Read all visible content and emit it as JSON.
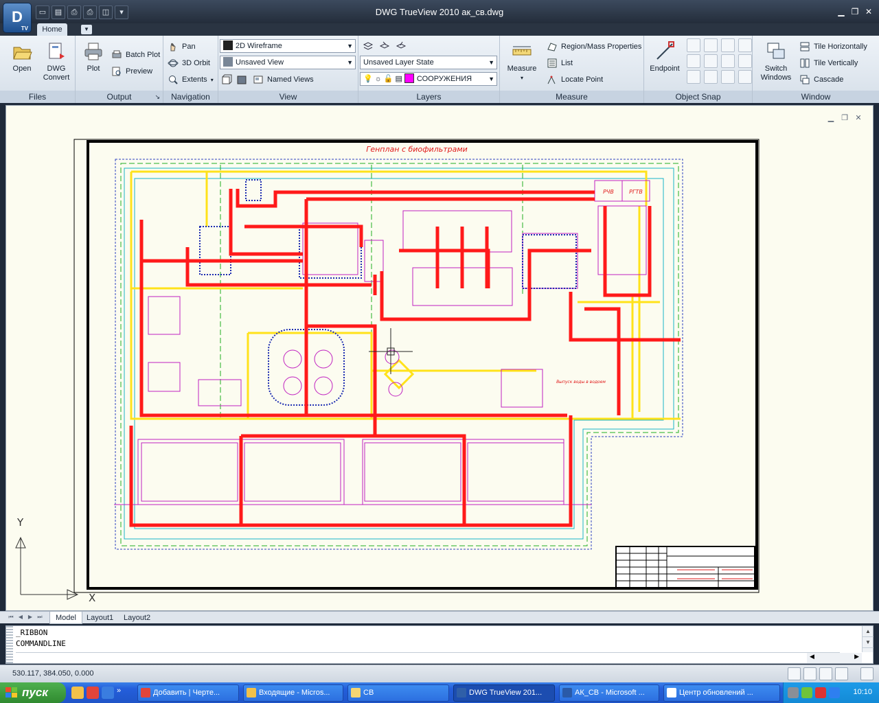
{
  "app": {
    "title": "DWG TrueView 2010    ак_св.dwg",
    "logo_text": "D",
    "logo_badge": "TV"
  },
  "tabs": {
    "home": "Home"
  },
  "ribbon": {
    "files": {
      "label": "Files",
      "open": "Open",
      "dwg_convert": "DWG\nConvert"
    },
    "output": {
      "label": "Output",
      "plot": "Plot",
      "batch_plot": "Batch Plot",
      "preview": "Preview"
    },
    "navigation": {
      "label": "Navigation",
      "pan": "Pan",
      "orbit": "3D Orbit",
      "extents": "Extents"
    },
    "view": {
      "label": "View",
      "visual_style": "2D Wireframe",
      "saved_view": "Unsaved View",
      "named_views": "Named Views"
    },
    "layers": {
      "label": "Layers",
      "layer_state": "Unsaved Layer State",
      "current_layer": "СООРУЖЕНИЯ",
      "layer_color": "#ff00ff"
    },
    "measure": {
      "label": "Measure",
      "measure": "Measure",
      "region": "Region/Mass Properties",
      "list": "List",
      "locate": "Locate Point"
    },
    "osnap": {
      "label": "Object Snap",
      "endpoint": "Endpoint"
    },
    "window": {
      "label": "Window",
      "switch": "Switch\nWindows",
      "tile_h": "Tile Horizontally",
      "tile_v": "Tile Vertically",
      "cascade": "Cascade"
    }
  },
  "drawing": {
    "title": "Генплан с биофильтрами",
    "label_rchv": "РЧВ",
    "label_rgtv": "РГТВ",
    "outlet_note": "Выпуск воды в водоем",
    "ucs_y": "Y",
    "ucs_x": "X"
  },
  "layout_tabs": [
    "Model",
    "Layout1",
    "Layout2"
  ],
  "cmdline": {
    "history": [
      "_RIBBON",
      "COMMANDLINE"
    ],
    "input_value": ""
  },
  "status": {
    "coords": "530.117, 384.050, 0.000"
  },
  "taskbar": {
    "start": "пуск",
    "tasks": [
      "Добавить | Черте...",
      "Входящие - Micros...",
      "СВ",
      "DWG TrueView 201...",
      "АК_СВ - Microsoft ...",
      "Центр обновлений ..."
    ],
    "clock": "10:10"
  }
}
